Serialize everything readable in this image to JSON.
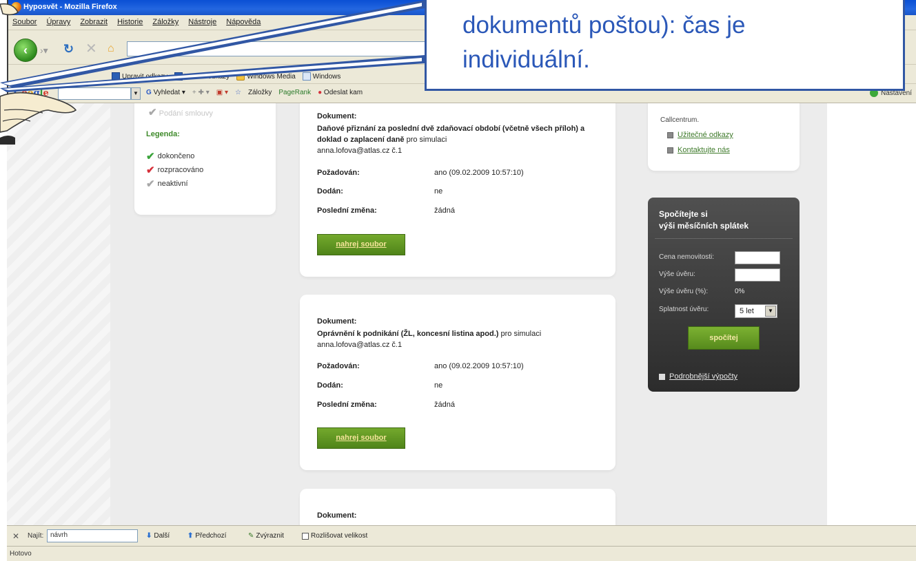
{
  "browser": {
    "title": "Hyposvět - Mozilla Firefox",
    "menu": [
      "Soubor",
      "Úpravy",
      "Zobrazit",
      "Historie",
      "Záložky",
      "Nástroje",
      "Nápověda"
    ],
    "bookmarks": [
      "Upravit odkazy",
      "Vlastní odkazy",
      "Windows Media",
      "Windows"
    ],
    "google_bar": {
      "logo": "Google",
      "search_label": "Vyhledat",
      "bookmarks_label": "Záložky",
      "pagerank_label": "PageRank",
      "send_label": "Odeslat kam",
      "right_label": "Nastavení"
    }
  },
  "callout": {
    "line1": "dokumentů poštou): čas je",
    "line2": "individuální."
  },
  "legend": {
    "faded_item": "Podání smlouvy",
    "title": "Legenda:",
    "items": [
      {
        "label": "dokončeno",
        "color": "#3aa33a"
      },
      {
        "label": "rozpracováno",
        "color": "#d6303a"
      },
      {
        "label": "neaktivní",
        "color": "#a8a8a8"
      }
    ]
  },
  "documents": [
    {
      "label": "Dokument:",
      "title_bold": "Daňové přiznání za poslední dvě zdaňovací období (včetně všech příloh) a doklad o zaplacení daně",
      "title_suffix": " pro simulaci",
      "email": "anna.lofova@atlas.cz č.1",
      "rows": [
        {
          "k": "Požadován:",
          "v": "ano (09.02.2009 10:57:10)"
        },
        {
          "k": "Dodán:",
          "v": "ne"
        },
        {
          "k": "Poslední změna:",
          "v": "žádná"
        }
      ],
      "button": "nahrej soubor"
    },
    {
      "label": "Dokument:",
      "title_bold": "Oprávnění k podnikání (ŽL, koncesní listina apod.)",
      "title_suffix": " pro simulaci",
      "email": "anna.lofova@atlas.cz č.1",
      "rows": [
        {
          "k": "Požadován:",
          "v": "ano (09.02.2009 10:57:10)"
        },
        {
          "k": "Dodán:",
          "v": "ne"
        },
        {
          "k": "Poslední změna:",
          "v": "žádná"
        }
      ],
      "button": "nahrej soubor"
    },
    {
      "label": "Dokument:"
    }
  ],
  "info": {
    "text": "Callcentrum.",
    "links": [
      "Užitečné odkazy",
      "Kontaktujte nás"
    ]
  },
  "calculator": {
    "title_line1": "Spočítejte si",
    "title_line2": "výši měsíčních splátek",
    "price_label": "Cena nemovitosti:",
    "loan_label": "Výše úvěru:",
    "loan_pct_label": "Výše úvěru (%):",
    "loan_pct_value": "0%",
    "term_label": "Splatnost úvěru:",
    "term_value": "5 let",
    "calc_button": "spočítej",
    "detail_link": "Podrobnější výpočty"
  },
  "findbar": {
    "label": "Najít:",
    "value": "návrh",
    "next": "Další",
    "prev": "Předchozí",
    "highlight": "Zvýraznit",
    "match_case": "Rozlišovat velikost"
  },
  "status": "Hotovo"
}
